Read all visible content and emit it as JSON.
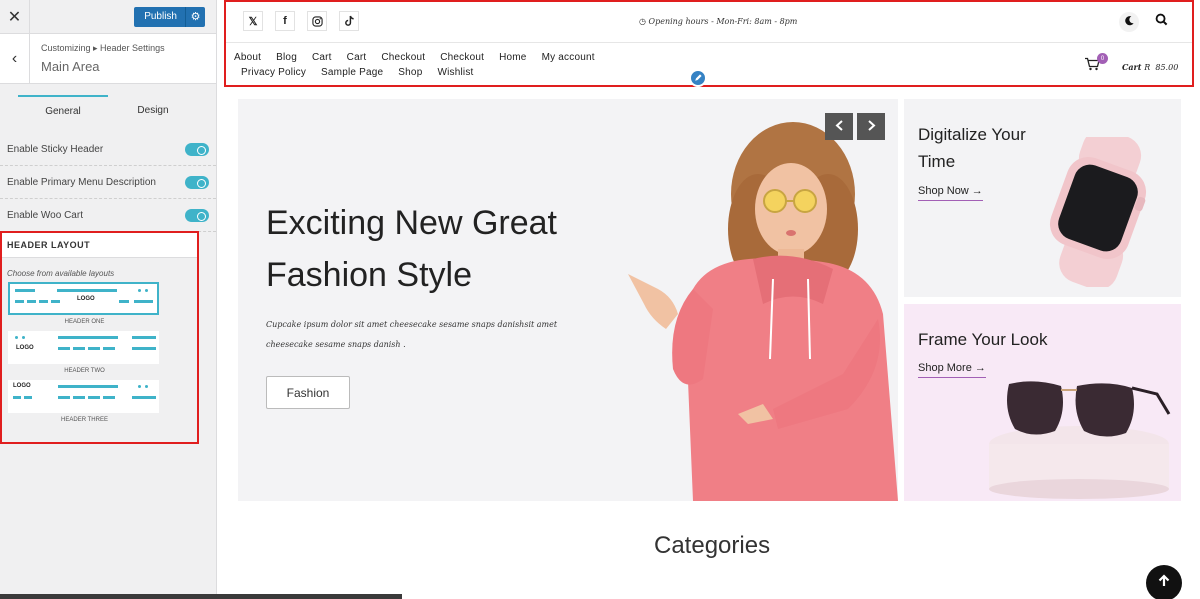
{
  "customizer": {
    "close_icon": "close-icon",
    "publish_label": "Publish",
    "settings_icon": "gear-icon",
    "breadcrumb": "Customizing ▸ Header Settings",
    "section_title": "Main Area",
    "tabs": [
      {
        "label": "General",
        "active": true
      },
      {
        "label": "Design",
        "active": false
      }
    ],
    "toggles": [
      {
        "label": "Enable Sticky Header",
        "on": true
      },
      {
        "label": "Enable Primary Menu Description",
        "on": true
      },
      {
        "label": "Enable Woo Cart",
        "on": true
      }
    ],
    "header_layout": {
      "heading": "HEADER LAYOUT",
      "hint": "Choose from available layouts",
      "options": [
        {
          "name": "HEADER ONE",
          "logo": "LOGO",
          "selected": true
        },
        {
          "name": "HEADER TWO",
          "logo": "LOGO",
          "selected": false
        },
        {
          "name": "HEADER THREE",
          "logo": "LOGO",
          "selected": false
        }
      ]
    },
    "accent": "#3fb3c9",
    "publish_color": "#2271b1"
  },
  "site": {
    "social_icons": [
      "x-icon",
      "facebook-icon",
      "instagram-icon",
      "tiktok-icon"
    ],
    "opening_hours": "Opening hours - Mon-Fri: 8am - 8pm",
    "menu_row1": [
      "About",
      "Blog",
      "Cart",
      "Cart",
      "Checkout",
      "Checkout",
      "Home",
      "My account"
    ],
    "menu_row2": [
      "Privacy Policy",
      "Sample Page",
      "Shop",
      "Wishlist"
    ],
    "cart": {
      "badge": "0",
      "label": "Cart",
      "amount": "R  85.00"
    },
    "hero": {
      "title": "Exciting New Great Fashion Style",
      "text": "Cupcake ipsum dolor sit amet cheesecake sesame snaps danishsit amet cheesecake sesame snaps danish .",
      "button": "Fashion"
    },
    "promos": [
      {
        "title": "Digitalize Your Time",
        "link": "Shop Now →"
      },
      {
        "title": "Frame Your Look",
        "link": "Shop More →"
      }
    ],
    "categories_title": "Categories",
    "highlight_color": "#e01e1e",
    "brand_purple": "#a25fb5"
  }
}
